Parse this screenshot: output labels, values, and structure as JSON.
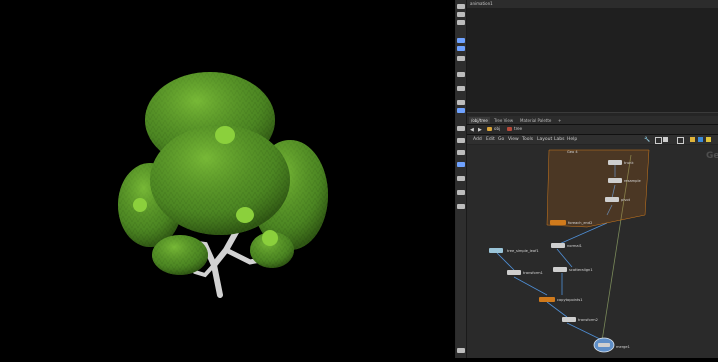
{
  "viewport": {
    "scene": "tree-leaves-render"
  },
  "upper_pane": {
    "tab_label": "animation1"
  },
  "network_tabs": [
    {
      "label": "/obj/tree",
      "active": true
    },
    {
      "label": "Tree View",
      "active": false
    },
    {
      "label": "Material Palette",
      "active": false
    },
    {
      "label": "+",
      "active": false
    }
  ],
  "path": {
    "obj": "obj",
    "node": "tree"
  },
  "menu": [
    "Add",
    "Edit",
    "Go",
    "View",
    "Tools",
    "Layout",
    "Labs",
    "Help"
  ],
  "context_label": "Ge",
  "nodes": {
    "tree_simple_leaf1": "tree_simple_leaf1",
    "transform1": "transform1",
    "scatteralign1": "scatteralign1",
    "copytopoints1": "copytopoints1",
    "transform2": "transform2",
    "merge1": "merge1",
    "foreach_end2": "foreach_end2",
    "normal1": "normal1",
    "trunk": "trunk",
    "resample": "resample",
    "pivot": "pivot",
    "group_hint": "Geo 4"
  },
  "colors": {
    "leaf": "#5d9c2c",
    "bark": "#cfcfcf",
    "wire": "#4f8fd6",
    "orange": "#d07a1c"
  }
}
